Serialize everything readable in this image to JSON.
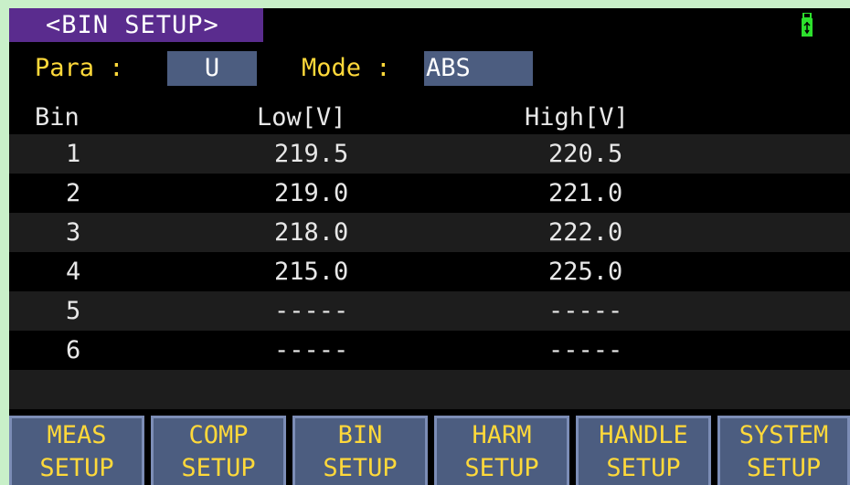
{
  "title": "<BIN  SETUP>",
  "params": {
    "para_label": "Para :",
    "para_value": "U",
    "mode_label": "Mode :",
    "mode_value": "ABS"
  },
  "table": {
    "headers": [
      "Bin",
      "Low[V]",
      "High[V]"
    ],
    "rows": [
      {
        "bin": "1",
        "low": "219.5",
        "high": "220.5"
      },
      {
        "bin": "2",
        "low": "219.0",
        "high": "221.0"
      },
      {
        "bin": "3",
        "low": "218.0",
        "high": "222.0"
      },
      {
        "bin": "4",
        "low": "215.0",
        "high": "225.0"
      },
      {
        "bin": "5",
        "low": "-----",
        "high": "-----"
      },
      {
        "bin": "6",
        "low": "-----",
        "high": "-----"
      }
    ]
  },
  "softkeys": [
    {
      "line1": "MEAS",
      "line2": "SETUP"
    },
    {
      "line1": "COMP",
      "line2": "SETUP"
    },
    {
      "line1": "BIN",
      "line2": "SETUP"
    },
    {
      "line1": "HARM",
      "line2": "SETUP"
    },
    {
      "line1": "HANDLE",
      "line2": "SETUP"
    },
    {
      "line1": "SYSTEM",
      "line2": "SETUP"
    }
  ],
  "icons": {
    "usb": "usb-drive-icon"
  },
  "colors": {
    "title_bg": "#5a2c8e",
    "label": "#ffd93a",
    "field_bg": "#4c5d80",
    "usb": "#2de02d"
  }
}
